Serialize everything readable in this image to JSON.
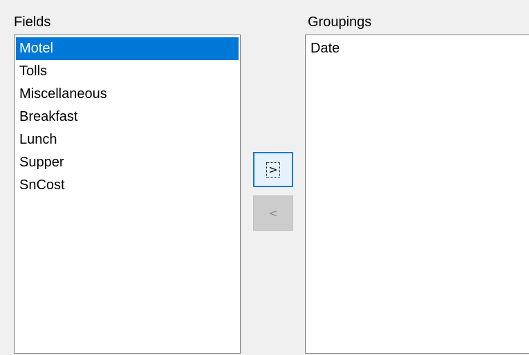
{
  "fields": {
    "label": "Fields",
    "items": [
      "Motel",
      "Tolls",
      "Miscellaneous",
      "Breakfast",
      "Lunch",
      "Supper",
      "SnCost"
    ],
    "selected": "Motel"
  },
  "groupings": {
    "label": "Groupings",
    "items": [
      "Date"
    ]
  },
  "buttons": {
    "add_label": ">",
    "remove_label": "<"
  },
  "colors": {
    "selection": "#0078d7",
    "background": "#f0f0f0"
  }
}
